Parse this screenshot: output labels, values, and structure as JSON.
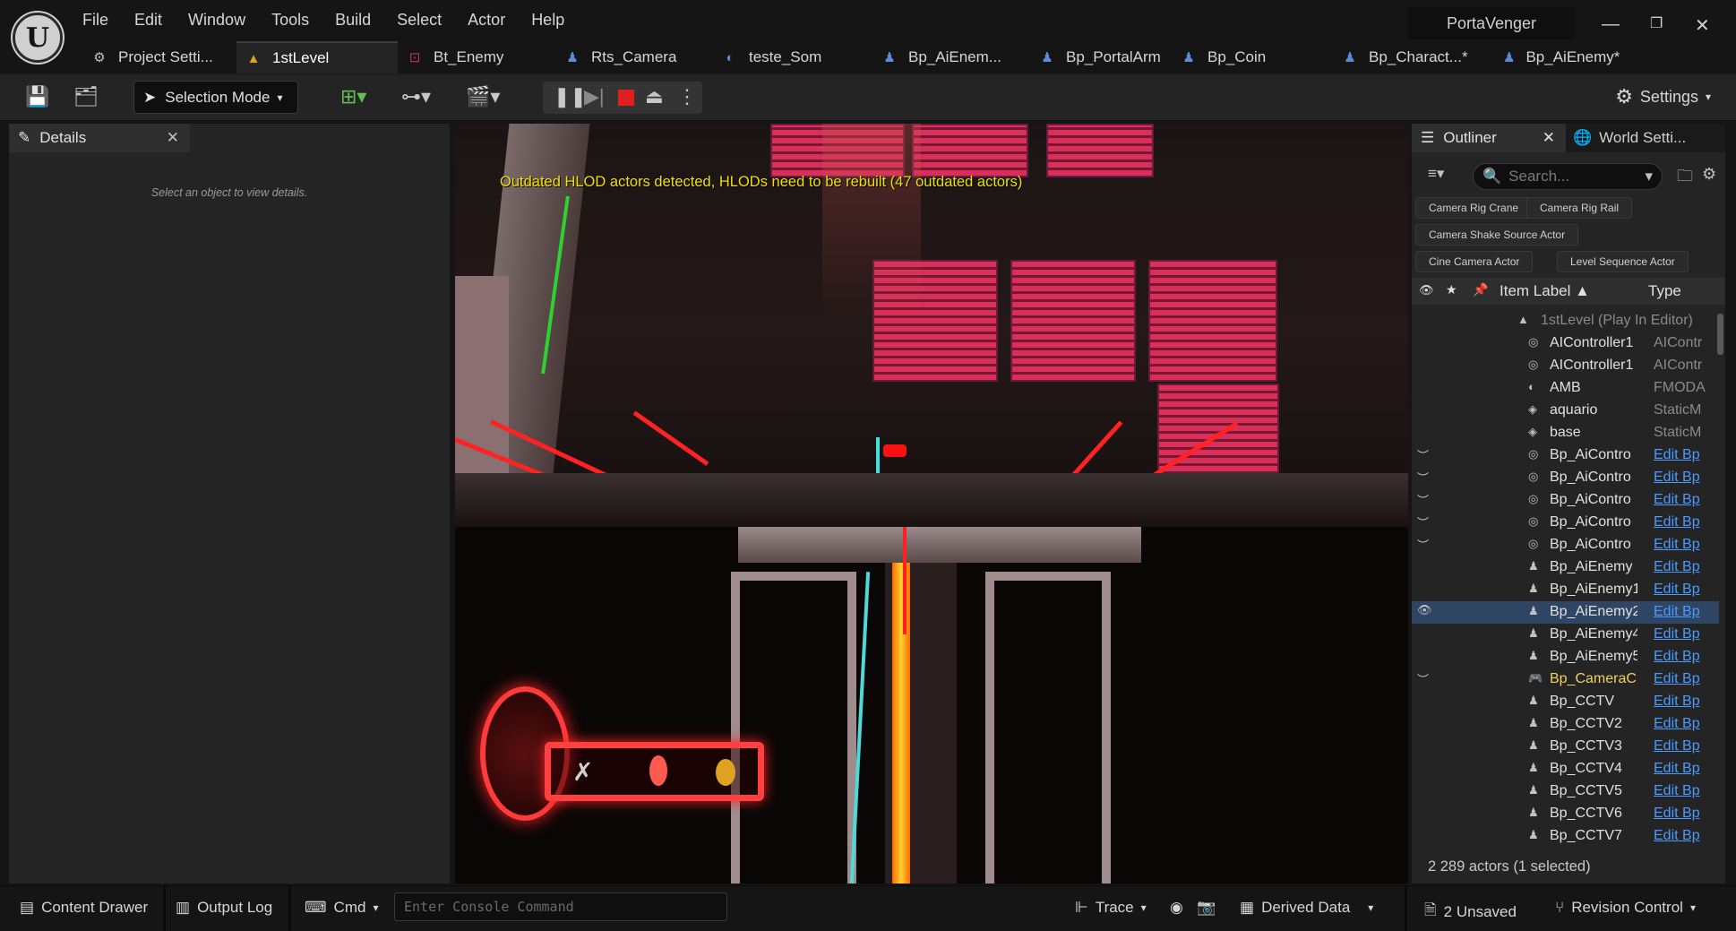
{
  "menu": [
    "File",
    "Edit",
    "Window",
    "Tools",
    "Build",
    "Select",
    "Actor",
    "Help"
  ],
  "project_name": "PortaVenger",
  "tabs": [
    {
      "label": "Project Setti...",
      "icon": "gear-icon",
      "color": "#c0c0c0"
    },
    {
      "label": "1stLevel",
      "icon": "level-icon",
      "color": "#e0a020"
    },
    {
      "label": "Bt_Enemy",
      "icon": "behavior-tree-icon",
      "color": "#c0306a"
    },
    {
      "label": "Rts_Camera",
      "icon": "blueprint-icon",
      "color": "#5a8ad8"
    },
    {
      "label": "teste_Som",
      "icon": "sound-icon",
      "color": "#5a8ad8"
    },
    {
      "label": "Bp_AiEnem...",
      "icon": "blueprint-icon",
      "color": "#5a8ad8"
    },
    {
      "label": "Bp_PortalArm",
      "icon": "blueprint-icon",
      "color": "#5a8ad8"
    },
    {
      "label": "Bp_Coin",
      "icon": "blueprint-icon",
      "color": "#5a8ad8"
    },
    {
      "label": "Bp_Charact...*",
      "icon": "blueprint-icon",
      "color": "#5a8ad8"
    },
    {
      "label": "Bp_AiEnemy*",
      "icon": "blueprint-icon",
      "color": "#5a8ad8"
    }
  ],
  "toolbar": {
    "selection_mode": "Selection Mode",
    "settings": "Settings"
  },
  "details": {
    "tab_label": "Details",
    "empty_text": "Select an object to view details."
  },
  "viewport": {
    "hlod_warning": "Outdated HLOD actors detected, HLODs need to be rebuilt (47 outdated actors)"
  },
  "outliner": {
    "tab_label": "Outliner",
    "world_settings_label": "World Setti...",
    "search_placeholder": "Search...",
    "filters": [
      "Camera Rig Crane",
      "Camera Rig Rail",
      "Camera Shake Source Actor",
      "Cine Camera Actor",
      "Level Sequence Actor"
    ],
    "col_label": "Item Label",
    "col_type": "Type",
    "rows": [
      {
        "label": "1stLevel (Play In Editor)",
        "type": "",
        "icon": "level-icon",
        "eye": "",
        "style": "dim"
      },
      {
        "label": "AIController1",
        "type": "AIContr",
        "icon": "controller-icon",
        "eye": "",
        "style": ""
      },
      {
        "label": "AIController1",
        "type": "AIContr",
        "icon": "controller-icon",
        "eye": "",
        "style": ""
      },
      {
        "label": "AMB",
        "type": "FMODA",
        "icon": "sound-icon",
        "eye": "",
        "style": ""
      },
      {
        "label": "aquario",
        "type": "StaticM",
        "icon": "mesh-icon",
        "eye": "",
        "style": ""
      },
      {
        "label": "base",
        "type": "StaticM",
        "icon": "mesh-icon",
        "eye": "",
        "style": ""
      },
      {
        "label": "Bp_AiContro",
        "type": "Edit Bp",
        "icon": "controller-icon",
        "eye": "closed",
        "style": "link"
      },
      {
        "label": "Bp_AiContro",
        "type": "Edit Bp",
        "icon": "controller-icon",
        "eye": "closed",
        "style": "link"
      },
      {
        "label": "Bp_AiContro",
        "type": "Edit Bp",
        "icon": "controller-icon",
        "eye": "closed",
        "style": "link"
      },
      {
        "label": "Bp_AiContro",
        "type": "Edit Bp",
        "icon": "controller-icon",
        "eye": "closed",
        "style": "link"
      },
      {
        "label": "Bp_AiContro",
        "type": "Edit Bp",
        "icon": "controller-icon",
        "eye": "closed",
        "style": "link"
      },
      {
        "label": "Bp_AiEnemy",
        "type": "Edit Bp",
        "icon": "pawn-icon",
        "eye": "",
        "style": "link"
      },
      {
        "label": "Bp_AiEnemy1",
        "type": "Edit Bp",
        "icon": "pawn-icon",
        "eye": "",
        "style": "link"
      },
      {
        "label": "Bp_AiEnemy2",
        "type": "Edit Bp",
        "icon": "pawn-icon",
        "eye": "open",
        "style": "link selected"
      },
      {
        "label": "Bp_AiEnemy4",
        "type": "Edit Bp",
        "icon": "pawn-icon",
        "eye": "",
        "style": "link"
      },
      {
        "label": "Bp_AiEnemy5",
        "type": "Edit Bp",
        "icon": "pawn-icon",
        "eye": "",
        "style": "link"
      },
      {
        "label": "Bp_CameraC",
        "type": "Edit Bp",
        "icon": "gamepad-icon",
        "eye": "closed",
        "style": "link yellow"
      },
      {
        "label": "Bp_CCTV",
        "type": "Edit Bp",
        "icon": "pawn-icon",
        "eye": "",
        "style": "link"
      },
      {
        "label": "Bp_CCTV2",
        "type": "Edit Bp",
        "icon": "pawn-icon",
        "eye": "",
        "style": "link"
      },
      {
        "label": "Bp_CCTV3",
        "type": "Edit Bp",
        "icon": "pawn-icon",
        "eye": "",
        "style": "link"
      },
      {
        "label": "Bp_CCTV4",
        "type": "Edit Bp",
        "icon": "pawn-icon",
        "eye": "",
        "style": "link"
      },
      {
        "label": "Bp_CCTV5",
        "type": "Edit Bp",
        "icon": "pawn-icon",
        "eye": "",
        "style": "link"
      },
      {
        "label": "Bp_CCTV6",
        "type": "Edit Bp",
        "icon": "pawn-icon",
        "eye": "",
        "style": "link"
      },
      {
        "label": "Bp_CCTV7",
        "type": "Edit Bp",
        "icon": "pawn-icon",
        "eye": "",
        "style": "link"
      }
    ],
    "status": "2 289 actors (1 selected)"
  },
  "statusbar": {
    "content_drawer": "Content Drawer",
    "output_log": "Output Log",
    "cmd": "Cmd",
    "console_placeholder": "Enter Console Command",
    "trace": "Trace",
    "derived_data": "Derived Data",
    "unsaved": "2 Unsaved",
    "revision_control": "Revision Control"
  }
}
